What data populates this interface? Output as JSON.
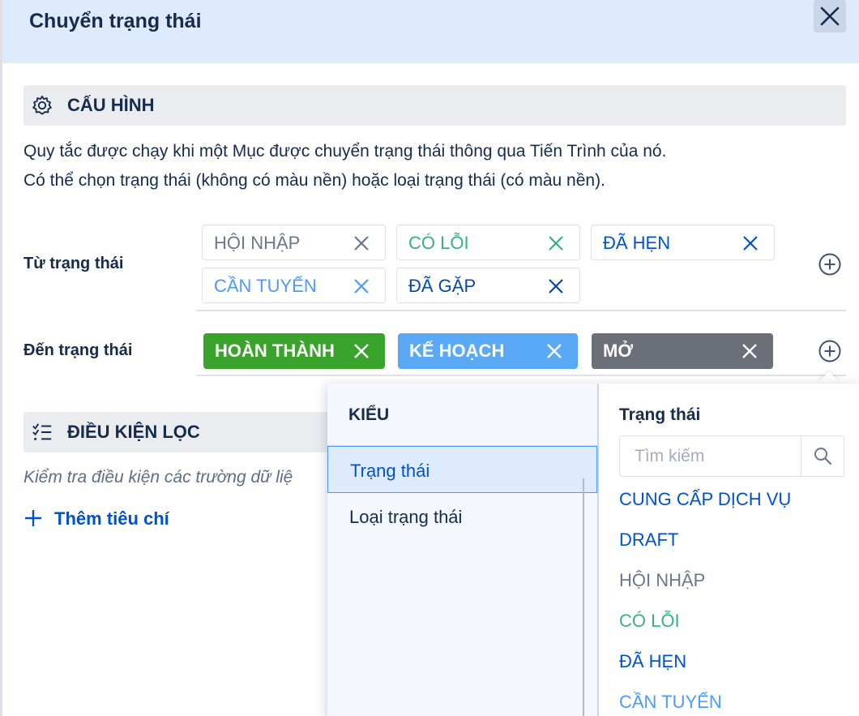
{
  "dialog": {
    "title": "Chuyển trạng thái"
  },
  "config_section": {
    "title": "CẤU HÌNH",
    "icon": "gear-icon",
    "desc_line1": "Quy tắc được chạy khi một Mục được chuyển trạng thái thông qua Tiến Trình của nó.",
    "desc_line2": "Có thể chọn trạng thái (không có màu nền) hoặc loại trạng thái (có màu nền)."
  },
  "from_status": {
    "label": "Từ trạng thái",
    "chips": [
      {
        "label": "HỘI NHẬP",
        "color": "#6b778c"
      },
      {
        "label": "CÓ LỖI",
        "color": "#36b37e"
      },
      {
        "label": "ĐÃ HẸN",
        "color": "#0052cc"
      },
      {
        "label": "CẦN TUYỂN",
        "color": "#4c9aff"
      },
      {
        "label": "ĐÃ GẶP",
        "color": "#0747a6"
      }
    ]
  },
  "to_status": {
    "label": "Đến trạng thái",
    "chips": [
      {
        "label": "HOÀN THÀNH",
        "bg": "#3aa32b"
      },
      {
        "label": "KẾ HOẠCH",
        "bg": "#5aa9f7"
      },
      {
        "label": "MỞ",
        "bg": "#6b6f78"
      }
    ]
  },
  "filter_section": {
    "title": "ĐIỀU KIỆN LỌC",
    "icon": "checklist-icon",
    "desc": "Kiểm tra điều kiện các trường dữ liệ",
    "add_label": "Thêm tiêu chí"
  },
  "popup": {
    "type_heading": "KIỂU",
    "type_options": [
      {
        "label": "Trạng thái",
        "selected": true
      },
      {
        "label": "Loại trạng thái",
        "selected": false
      }
    ],
    "status_heading": "Trạng thái",
    "search_placeholder": "Tìm kiếm",
    "statuses": [
      {
        "label": "CUNG CẤP DỊCH VỤ",
        "color": "#0052cc"
      },
      {
        "label": "DRAFT",
        "color": "#0052cc"
      },
      {
        "label": "HỘI NHẬP",
        "color": "#6b778c"
      },
      {
        "label": "CÓ LỖI",
        "color": "#36b37e"
      },
      {
        "label": "ĐÃ HẸN",
        "color": "#0052cc"
      },
      {
        "label": "CẦN TUYỂN",
        "color": "#4c9aff"
      }
    ]
  }
}
